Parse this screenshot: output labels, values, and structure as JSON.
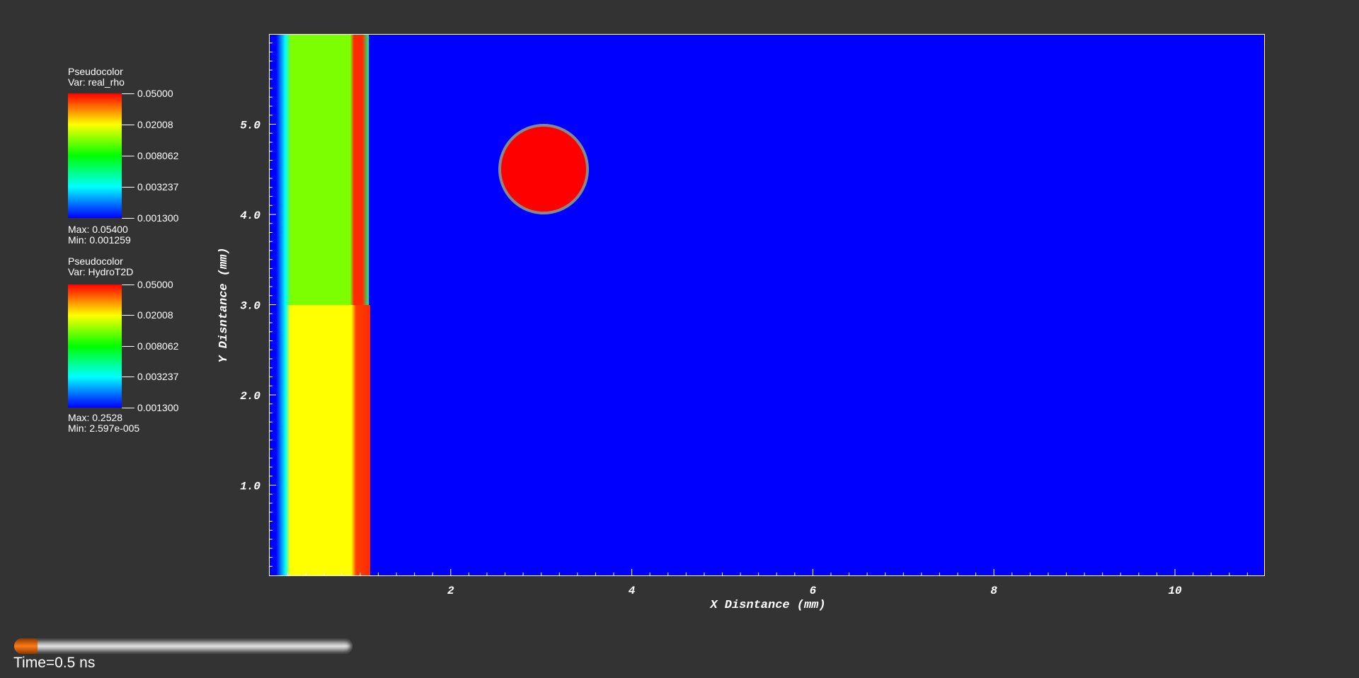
{
  "legends": [
    {
      "title": "Pseudocolor",
      "var": "Var: real_rho",
      "ticks": [
        "0.05000",
        "0.02008",
        "0.008062",
        "0.003237",
        "0.001300"
      ],
      "max": "Max:  0.05400",
      "min": "Min:  0.001259"
    },
    {
      "title": "Pseudocolor",
      "var": "Var: HydroT2D",
      "ticks": [
        "0.05000",
        "0.02008",
        "0.008062",
        "0.003237",
        "0.001300"
      ],
      "max": "Max:  0.2528",
      "min": "Min:  2.597e-005"
    }
  ],
  "colorbar_colors": [
    "#ff0000",
    "#ffff00",
    "#00ff00",
    "#00ffff",
    "#0000ff"
  ],
  "plot": {
    "xlabel": "X Disntance (mm)",
    "ylabel": "Y Disntance (mm)",
    "xticks": [
      "2",
      "4",
      "6",
      "8",
      "10"
    ],
    "yticks": [
      "1.0",
      "2.0",
      "3.0",
      "4.0",
      "5.0"
    ],
    "background_color": "#0000ff"
  },
  "time": {
    "label": "Time=0.5 ns",
    "progress": 0.07
  }
}
